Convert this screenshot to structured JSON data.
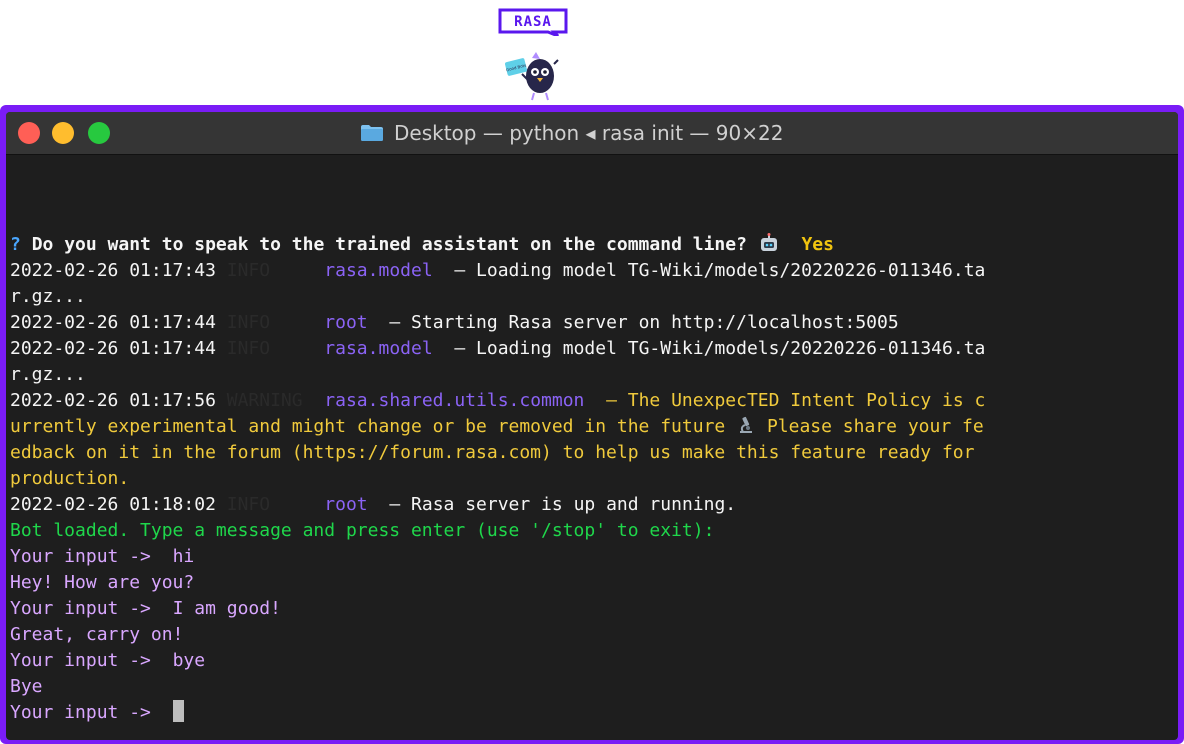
{
  "logo": {
    "text": "RASA",
    "mascot_sign": "Good Bots"
  },
  "window": {
    "title": "Desktop — python ◂ rasa init — 90×22",
    "colors": {
      "close": "#ff5f56",
      "minimize": "#ffbd2e",
      "maximize": "#27c93f",
      "frame": "#7a1cf6"
    }
  },
  "terminal": {
    "question": "Do you want to speak to the trained assistant on the command line?",
    "question_prefix": "?",
    "answer": "Yes",
    "log": [
      {
        "time": "2022-02-26 01:17:43",
        "level": "INFO",
        "module": "rasa.model",
        "msg": "– Loading model TG-Wiki/models/20220226-011346.ta"
      },
      {
        "cont": "r.gz..."
      },
      {
        "time": "2022-02-26 01:17:44",
        "level": "INFO",
        "module": "root",
        "msg": "– Starting Rasa server on http://localhost:5005"
      },
      {
        "time": "2022-02-26 01:17:44",
        "level": "INFO",
        "module": "rasa.model",
        "msg": "– Loading model TG-Wiki/models/20220226-011346.ta"
      },
      {
        "cont": "r.gz..."
      },
      {
        "time": "2022-02-26 01:17:56",
        "level": "WARNING",
        "module": "rasa.shared.utils.common",
        "msg": "– The UnexpecTED Intent Policy is c"
      },
      {
        "warn_cont_1": "urrently experimental and might change or be removed in the future",
        "warn_cont_1b": "Please share your fe"
      },
      {
        "warn_cont_2": "edback on it in the forum (https://forum.rasa.com) to help us make this feature ready for"
      },
      {
        "warn_cont_3": "production."
      },
      {
        "time": "2022-02-26 01:18:02",
        "level": "INFO",
        "module": "root",
        "msg": "– Rasa server is up and running."
      }
    ],
    "bot_loaded": "Bot loaded. Type a message and press enter (use '/stop' to exit):",
    "chat": [
      {
        "prompt": "Your input ->",
        "text": "hi"
      },
      {
        "reply": "Hey! How are you?"
      },
      {
        "prompt": "Your input ->",
        "text": "I am good!"
      },
      {
        "reply": "Great, carry on!"
      },
      {
        "prompt": "Your input ->",
        "text": "bye"
      },
      {
        "reply": "Bye"
      },
      {
        "prompt": "Your input ->",
        "text": ""
      }
    ],
    "icons": {
      "question_icon": "robot-emoji-icon",
      "warning_icon": "microscope-emoji-icon"
    }
  }
}
